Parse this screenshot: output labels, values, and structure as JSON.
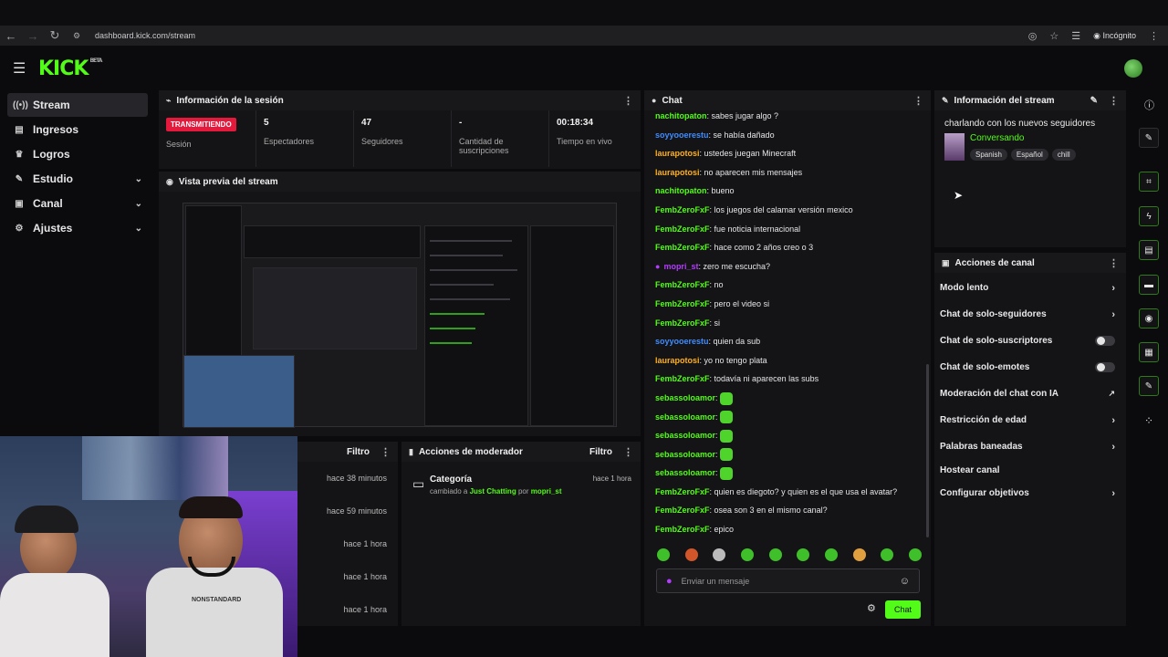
{
  "browser": {
    "url": "dashboard.kick.com/stream",
    "incognito_label": "Incógnito"
  },
  "app": {
    "logo": "KICK",
    "beta": "BETA"
  },
  "sidebar": {
    "items": [
      {
        "label": "Stream",
        "icon": "radio-icon"
      },
      {
        "label": "Ingresos",
        "icon": "money-icon"
      },
      {
        "label": "Logros",
        "icon": "trophy-icon"
      },
      {
        "label": "Estudio",
        "icon": "edit-icon"
      },
      {
        "label": "Canal",
        "icon": "tv-icon"
      },
      {
        "label": "Ajustes",
        "icon": "gear-icon"
      }
    ]
  },
  "session": {
    "title": "Información de la sesión",
    "status": "TRANSMITIENDO",
    "status_label": "Sesión",
    "viewers": "5",
    "viewers_label": "Espectadores",
    "followers": "47",
    "followers_label": "Seguidores",
    "subs": "-",
    "subs_label_1": "Cantidad de",
    "subs_label_2": "suscripciones",
    "uptime": "00:18:34",
    "uptime_label": "Tiempo en vivo"
  },
  "preview": {
    "title": "Vista previa del stream"
  },
  "activity": {
    "filter": "Filtro",
    "times": [
      "hace 38 minutos",
      "hace 59 minutos",
      "hace 1 hora",
      "hace 1 hora",
      "hace 1 hora"
    ]
  },
  "mod_actions": {
    "title": "Acciones de moderador",
    "filter": "Filtro",
    "entry": {
      "title": "Categoría",
      "time": "hace 1 hora",
      "desc_pre": "cambiado a",
      "category": "Just Chatting",
      "desc_mid": "por",
      "user": "mopri_st"
    }
  },
  "chat": {
    "title": "Chat",
    "messages": [
      {
        "user": "nachitopaton",
        "color": "green",
        "text": "sabes jugar algo ?"
      },
      {
        "user": "soyyooerestu",
        "color": "blue",
        "text": "se había dañado"
      },
      {
        "user": "laurapotosi",
        "color": "orange",
        "text": "ustedes juegan Minecraft"
      },
      {
        "user": "laurapotosi",
        "color": "orange",
        "text": "no aparecen mis mensajes"
      },
      {
        "user": "nachitopaton",
        "color": "green",
        "text": "bueno"
      },
      {
        "user": "FembZeroFxF",
        "color": "green",
        "text": "los juegos del calamar versión mexico"
      },
      {
        "user": "FembZeroFxF",
        "color": "green",
        "text": "fue noticia internacional"
      },
      {
        "user": "FembZeroFxF",
        "color": "green",
        "text": "hace como 2 años creo o 3"
      },
      {
        "user": "mopri_st",
        "color": "purple",
        "text": "zero me escucha?"
      },
      {
        "user": "FembZeroFxF",
        "color": "green",
        "text": "no"
      },
      {
        "user": "FembZeroFxF",
        "color": "green",
        "text": "pero el video si"
      },
      {
        "user": "FembZeroFxF",
        "color": "green",
        "text": "si"
      },
      {
        "user": "soyyooerestu",
        "color": "blue",
        "text": "quien da sub"
      },
      {
        "user": "laurapotosi",
        "color": "orange",
        "text": "yo no tengo plata"
      },
      {
        "user": "FembZeroFxF",
        "color": "green",
        "text": "todavía ni aparecen las subs"
      },
      {
        "user": "sebassoloamor",
        "color": "green",
        "text": ""
      },
      {
        "user": "sebassoloamor",
        "color": "green",
        "text": ""
      },
      {
        "user": "sebassoloamor",
        "color": "green",
        "text": ""
      },
      {
        "user": "sebassoloamor",
        "color": "green",
        "text": ""
      },
      {
        "user": "sebassoloamor",
        "color": "green",
        "text": ""
      },
      {
        "user": "FembZeroFxF",
        "color": "green",
        "text": "quien es diegoto? y quien es el que usa el avatar?"
      },
      {
        "user": "FembZeroFxF",
        "color": "green",
        "text": "osea son 3 en el mismo canal?"
      },
      {
        "user": "FembZeroFxF",
        "color": "green",
        "text": "epico"
      }
    ],
    "input_placeholder": "Enviar un mensaje",
    "send_label": "Chat"
  },
  "stream_info": {
    "title": "Información del stream",
    "stream_title": "charlando con los nuevos seguidores",
    "category": "Conversando",
    "tags": [
      "Spanish",
      "Español",
      "chill"
    ]
  },
  "channel_actions": {
    "title": "Acciones de canal",
    "items": [
      {
        "label": "Modo lento",
        "control": "chevron"
      },
      {
        "label": "Chat de solo-seguidores",
        "control": "chevron"
      },
      {
        "label": "Chat de solo-suscriptores",
        "control": "toggle"
      },
      {
        "label": "Chat de solo-emotes",
        "control": "toggle"
      },
      {
        "label": "Moderación del chat con IA",
        "control": "external"
      },
      {
        "label": "Restricción de edad",
        "control": "chevron"
      },
      {
        "label": "Palabras baneadas",
        "control": "chevron"
      },
      {
        "label": "Hostear canal",
        "control": "none"
      },
      {
        "label": "Configurar objetivos",
        "control": "chevron"
      }
    ]
  },
  "webcam": {
    "shirt_text": "NONSTANDARD"
  }
}
